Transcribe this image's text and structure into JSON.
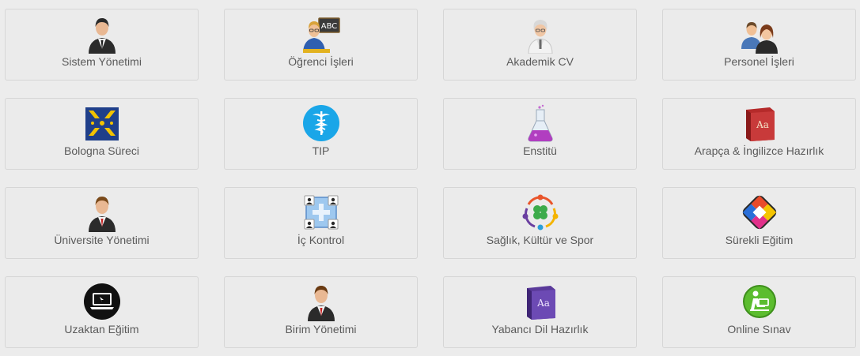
{
  "tiles": [
    {
      "label": "Sistem Yönetimi",
      "icon": "businessman-icon"
    },
    {
      "label": "Öğrenci İşleri",
      "icon": "student-blackboard-icon"
    },
    {
      "label": "Akademik CV",
      "icon": "professor-icon"
    },
    {
      "label": "Personel İşleri",
      "icon": "users-pair-icon"
    },
    {
      "label": "Bologna Süreci",
      "icon": "bologna-logo-icon"
    },
    {
      "label": "TIP",
      "icon": "caduceus-icon"
    },
    {
      "label": "Enstitü",
      "icon": "flask-icon"
    },
    {
      "label": "Arapça & İngilizce Hazırlık",
      "icon": "dictionary-red-icon"
    },
    {
      "label": "Üniversite Yönetimi",
      "icon": "manager-icon"
    },
    {
      "label": "İç Kontrol",
      "icon": "network-users-icon"
    },
    {
      "label": "Sağlık, Kültür ve Spor",
      "icon": "community-clover-icon"
    },
    {
      "label": "Sürekli Eğitim",
      "icon": "colorful-cycle-icon"
    },
    {
      "label": "Uzaktan Eğitim",
      "icon": "laptop-icon"
    },
    {
      "label": "Birim Yönetimi",
      "icon": "manager-red-tie-icon"
    },
    {
      "label": "Yabancı Dil Hazırlık",
      "icon": "dictionary-purple-icon"
    },
    {
      "label": "Online Sınav",
      "icon": "online-exam-icon"
    }
  ]
}
